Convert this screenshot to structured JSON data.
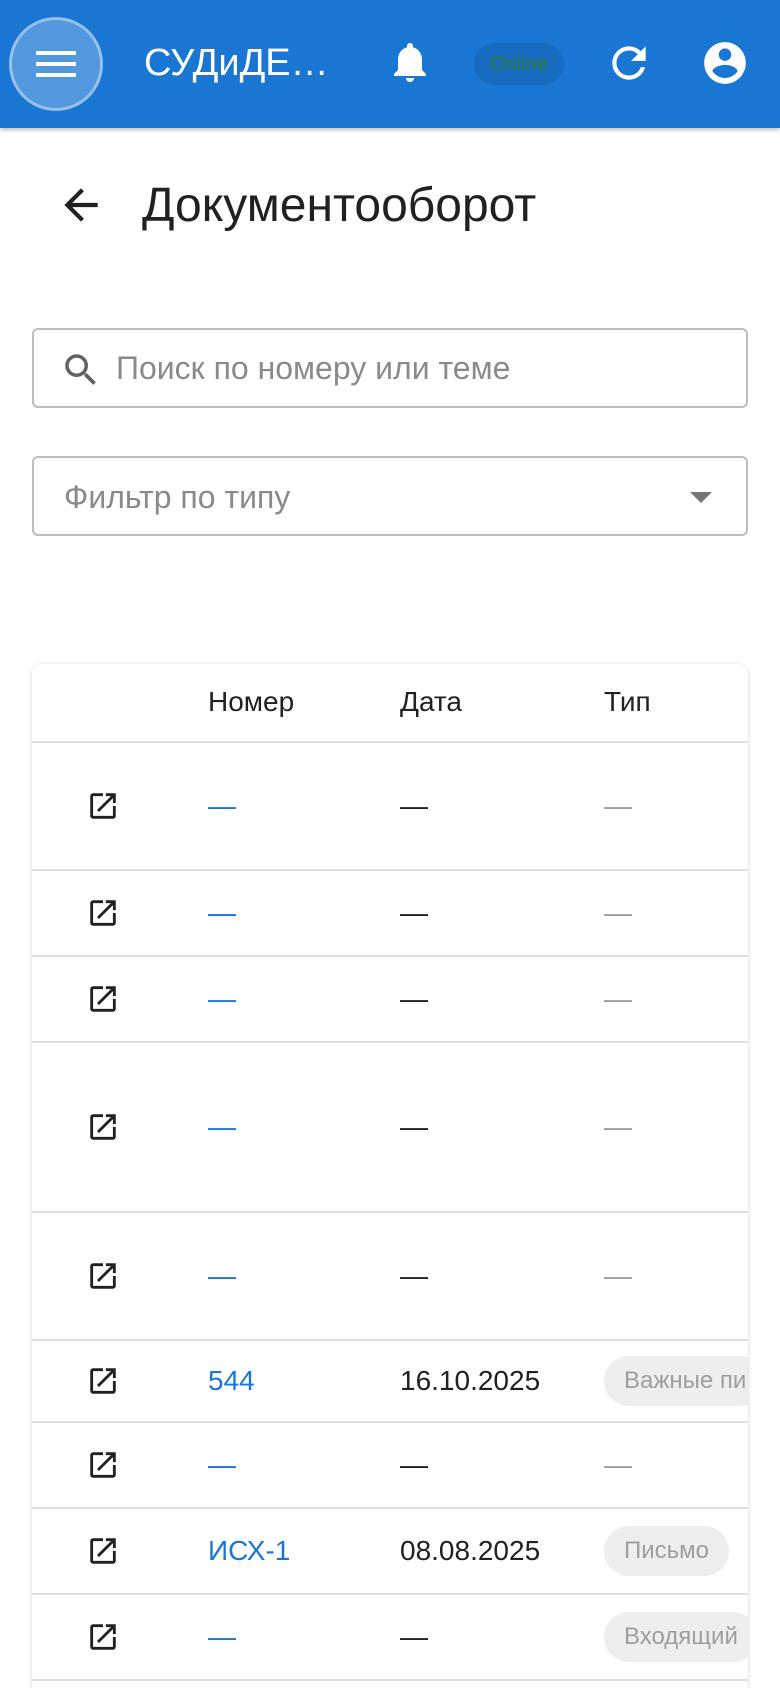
{
  "app_bar": {
    "title": "СУДиДЕ…",
    "status": "Online",
    "icons": [
      "menu-icon",
      "bell-icon",
      "refresh-icon",
      "account-circle-icon"
    ]
  },
  "page": {
    "title": "Документооборот",
    "back_icon": "arrow-back-icon"
  },
  "search": {
    "placeholder": "Поиск по номеру или теме",
    "value": ""
  },
  "filter": {
    "label": "Фильтр по типу"
  },
  "table": {
    "headers": [
      "Номер",
      "Дата",
      "Тип"
    ],
    "rows": [
      {
        "number": "—",
        "date": "—",
        "type": "—"
      },
      {
        "number": "—",
        "date": "—",
        "type": "—"
      },
      {
        "number": "—",
        "date": "—",
        "type": "—"
      },
      {
        "number": "—",
        "date": "—",
        "type": "—"
      },
      {
        "number": "—",
        "date": "—",
        "type": "—"
      },
      {
        "number": "544",
        "date": "16.10.2025",
        "type": "Важные пи"
      },
      {
        "number": "—",
        "date": "—",
        "type": "—"
      },
      {
        "number": "ИСХ-1",
        "date": "08.08.2025",
        "type": "Письмо"
      },
      {
        "number": "—",
        "date": "—",
        "type": "Входящий"
      }
    ]
  },
  "colors": {
    "primary": "#1976d2",
    "status_text": "#2e7d32",
    "link": "#1976d2",
    "chip_bg": "#eeeeee"
  }
}
